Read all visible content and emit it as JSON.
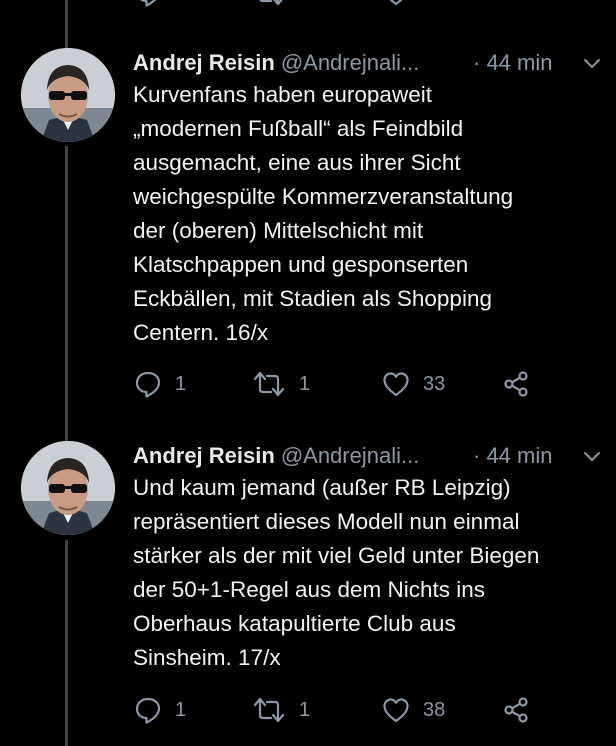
{
  "tweets": [
    {
      "name": "Andrej Reisin",
      "handle": "@Andrejnali...",
      "time": "· 44 min",
      "text": "Kurvenfans haben europaweit\n„modernen Fußball“ als Feindbild\nausgemacht, eine aus ihrer Sicht\nweichgespülte Kommerzveranstaltung\nder (oberen) Mittelschicht mit\nKlatschpappen und gesponserten\nEckbällen, mit Stadien als Shopping\nCentern. 16/x",
      "replies": "1",
      "retweets": "1",
      "likes": "33"
    },
    {
      "name": "Andrej Reisin",
      "handle": "@Andrejnali...",
      "time": "· 44 min",
      "text": "Und kaum jemand (außer RB Leipzig)\nrepräsentiert dieses Modell nun einmal\nstärker als der mit viel Geld unter Biegen\nder 50+1-Regel aus dem Nichts ins\nOberhaus katapultierte Club aus\nSinsheim. 17/x",
      "replies": "1",
      "retweets": "1",
      "likes": "38"
    }
  ],
  "icons": {
    "reply": "reply-icon",
    "retweet": "retweet-icon",
    "like": "heart-icon",
    "share": "share-icon",
    "menu": "chevron-down-icon"
  },
  "colors": {
    "background": "#000000",
    "text": "#e7e9ea",
    "muted": "#8b98a5",
    "thread_line": "#3d4043"
  }
}
